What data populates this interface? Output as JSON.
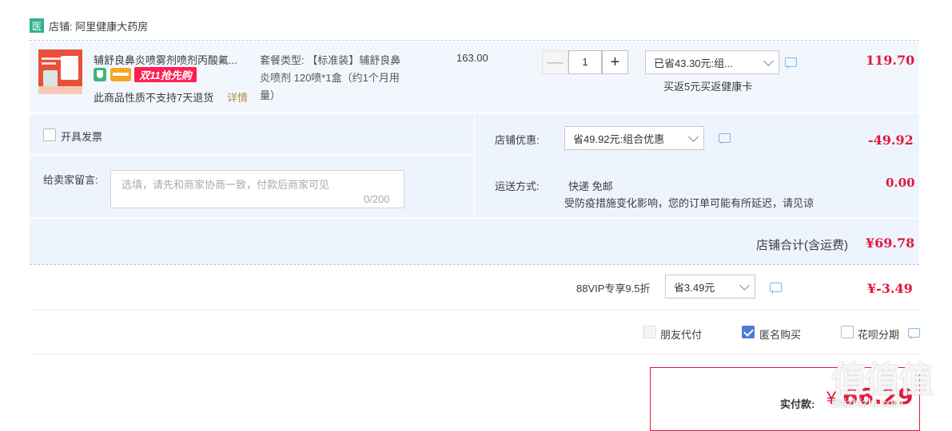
{
  "shop": {
    "badge": "医",
    "label": "店铺: 阿里健康大药房"
  },
  "item": {
    "title": "辅舒良鼻炎喷雾剂喷剂丙酸氟...",
    "promo_tag": "双11抢先购",
    "return_note": "此商品性质不支持7天退货",
    "return_detail": "详情",
    "sku_line1": "套餐类型: 【标准装】辅舒良鼻",
    "sku_line2": "炎喷剂 120喷*1盒（约1个月用",
    "sku_line3": "量）",
    "unit_price": "163.00",
    "quantity": "1",
    "qty_minus": "—",
    "qty_plus": "+",
    "discount_select": "已省43.30元:组...",
    "coupon_note": "买返5元买返健康卡",
    "subtotal": "119.70"
  },
  "invoice": {
    "label": "开具发票"
  },
  "message": {
    "label": "给卖家留言:",
    "placeholder": "选填，请先和商家协商一致，付款后商家可见",
    "count": "0/200"
  },
  "shop_discount": {
    "label": "店铺优惠:",
    "select": "省49.92元:组合优惠",
    "amount": "-49.92"
  },
  "shipping": {
    "label": "运送方式:",
    "method": "快递 免邮",
    "note": "受防疫措施变化影响，您的订单可能有所延迟，请见谅",
    "amount": "0.00"
  },
  "shop_total": {
    "label": "店铺合计(含运费)",
    "amount": "¥69.78"
  },
  "vip": {
    "label": "88VIP专享9.5折",
    "select": "省3.49元",
    "amount": "¥-3.49"
  },
  "options": {
    "friend_pay": "朋友代付",
    "anonymous": "匿名购买",
    "installment": "花呗分期"
  },
  "payment": {
    "label": "实付款:",
    "currency": "¥",
    "amount": "66.29"
  },
  "watermark": {
    "main": "值值值",
    "sub": "zhizhizhi.com"
  },
  "colors": {
    "price_red": "#e4173b",
    "panel_blue": "#eef4fd",
    "shop_badge": "#2fb48e",
    "promo_red": "#ff1e50"
  }
}
